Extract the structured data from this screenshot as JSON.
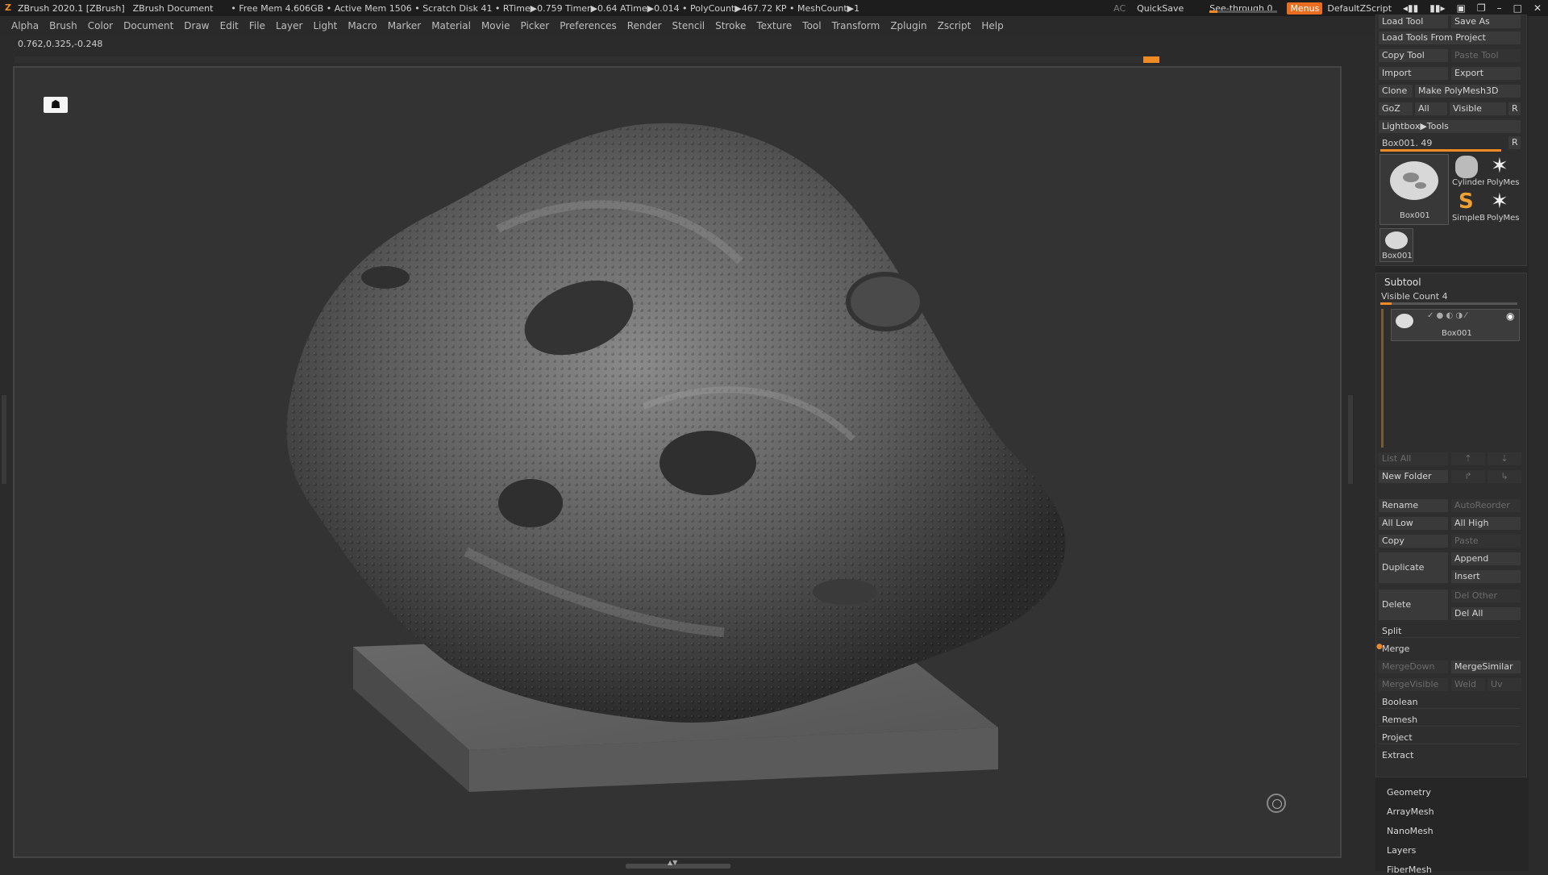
{
  "titlebar": {
    "app": "ZBrush 2020.1 [ZBrush]",
    "doc": "ZBrush Document",
    "stats": "• Free Mem 4.606GB • Active Mem 1506 • Scratch Disk 41 •  RTime▶0.759 Timer▶0.64 ATime▶0.014 • PolyCount▶467.72 KP • MeshCount▶1",
    "ac": "AC",
    "quicksave": "QuickSave",
    "seethrough": "See-through  0",
    "menus": "Menus",
    "script": "DefaultZScript"
  },
  "menubar": [
    "Alpha",
    "Brush",
    "Color",
    "Document",
    "Draw",
    "Edit",
    "File",
    "Layer",
    "Light",
    "Macro",
    "Marker",
    "Material",
    "Movie",
    "Picker",
    "Preferences",
    "Render",
    "Stencil",
    "Stroke",
    "Texture",
    "Tool",
    "Transform",
    "Zplugin",
    "Zscript",
    "Help"
  ],
  "coords": "0.762,0.325,-0.248",
  "tool": {
    "load_tool": "Load Tool",
    "save_as": "Save As",
    "load_from_project": "Load Tools From Project",
    "copy_tool": "Copy Tool",
    "paste_tool": "Paste Tool",
    "import": "Import",
    "export": "Export",
    "clone": "Clone",
    "make_polymesh": "Make PolyMesh3D",
    "goz": "GoZ",
    "all": "All",
    "visible": "Visible",
    "r": "R",
    "lightbox": "Lightbox▶Tools",
    "current": "Box001. 49",
    "thumb_main": "Box001",
    "thumb_cylinder": "Cylinder",
    "thumb_polymesh1": "PolyMes",
    "thumb_simpleb": "SimpleB",
    "thumb_polymesh2": "PolyMes",
    "thumb_small": "Box001"
  },
  "subtool": {
    "title": "Subtool",
    "visible_count": "Visible Count 4",
    "item": "Box001",
    "list_all": "List All",
    "new_folder": "New Folder",
    "rename": "Rename",
    "autoreorder": "AutoReorder",
    "all_low": "All Low",
    "all_high": "All High",
    "copy": "Copy",
    "paste": "Paste",
    "duplicate": "Duplicate",
    "append": "Append",
    "insert": "Insert",
    "delete": "Delete",
    "del_other": "Del Other",
    "del_all": "Del All",
    "split": "Split",
    "merge": "Merge",
    "mergedown": "MergeDown",
    "mergesimilar": "MergeSimilar",
    "mergevisible": "MergeVisible",
    "weld": "Weld",
    "uv": "Uv",
    "boolean": "Boolean",
    "remesh": "Remesh",
    "project": "Project",
    "extract": "Extract"
  },
  "menus": [
    "Geometry",
    "ArrayMesh",
    "NanoMesh",
    "Layers",
    "FiberMesh"
  ],
  "accent": "#f08a24"
}
